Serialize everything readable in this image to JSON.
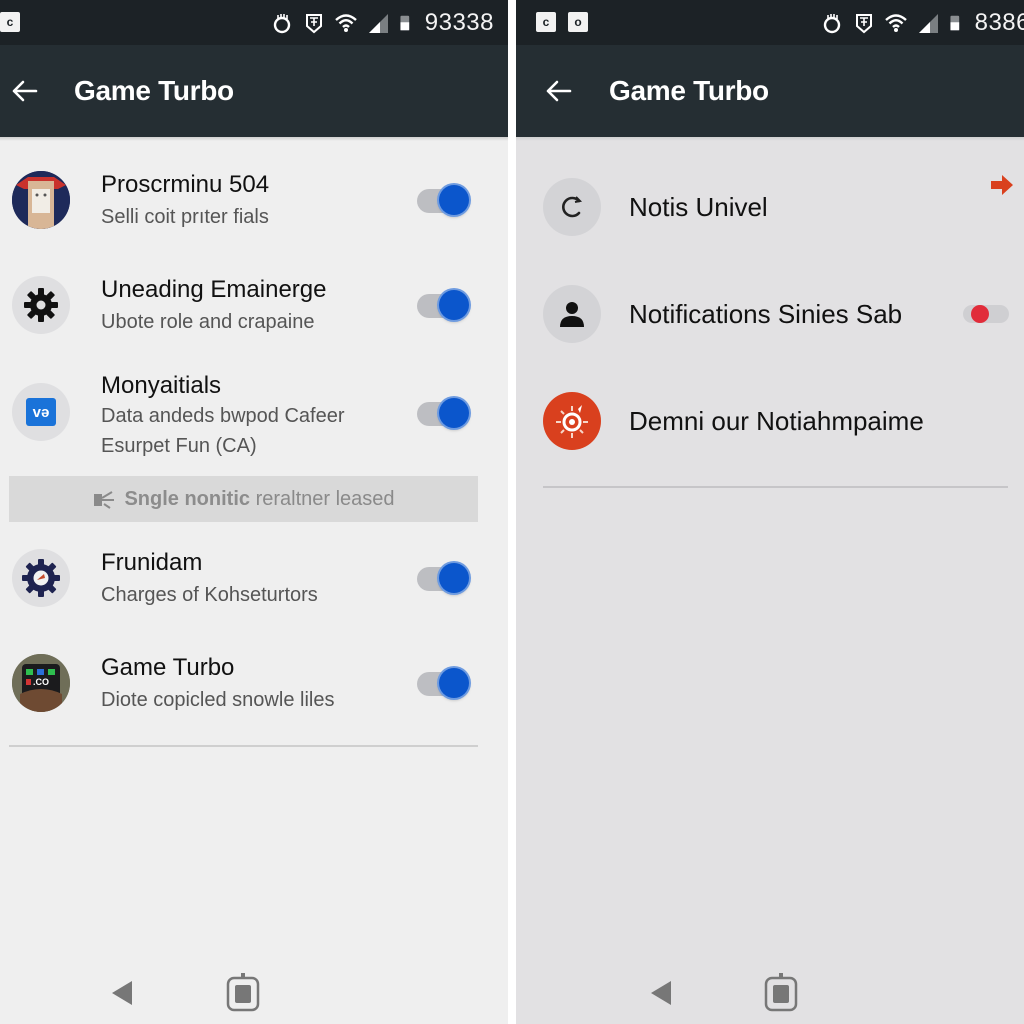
{
  "left": {
    "status_bar": {
      "notification_icons": [
        "c-app-icon"
      ],
      "time_text": "93338"
    },
    "app_bar": {
      "title": "Game Turbo"
    },
    "items": [
      {
        "title": "Proscrminu 504",
        "subtitle": "Selli coit prıter fials",
        "icon": "app-portrait-icon",
        "toggle_on": true
      },
      {
        "title": "Uneading Emainerge",
        "subtitle": "Ubote role and crapaine",
        "icon": "gear-icon",
        "toggle_on": true
      },
      {
        "title": "Monyaitials",
        "subtitle_lines": [
          "Data andeds bwpod Cafeer",
          "Esurpet Fun (CA)"
        ],
        "icon": "vpn-app-icon",
        "toggle_on": true
      },
      {
        "title": "Frunidam",
        "subtitle": "Charges of Kohseturtors",
        "icon": "gear-badge-icon",
        "toggle_on": true
      },
      {
        "title": "Game Turbo",
        "subtitle": "Diote copicled snowle liles",
        "icon": "game-turbo-app-icon",
        "toggle_on": true
      }
    ],
    "notice": {
      "bold_text": "Sngle nonitic",
      "text": "reraltner leased"
    },
    "nav": {
      "back": "back-nav",
      "home": "home-nav"
    }
  },
  "right": {
    "status_bar": {
      "notification_icons": [
        "c-app-icon",
        "o-app-icon"
      ],
      "time_text": "8386"
    },
    "app_bar": {
      "title": "Game Turbo"
    },
    "items": [
      {
        "title": "Notis Univel",
        "icon": "refresh-icon",
        "trailing": "arrow-right-icon"
      },
      {
        "title": "Notifications Sinies Sab",
        "icon": "person-icon",
        "toggle_on": false
      },
      {
        "title": "Demni our Notiahmpaime",
        "icon": "burst-icon"
      }
    ],
    "nav": {
      "back": "back-nav",
      "home": "home-nav"
    }
  },
  "colors": {
    "status_bar": "#1c2226",
    "app_bar": "#252e33",
    "toggle_on": "#0b56cc",
    "toggle_off_thumb": "#e12c3a",
    "accent_orange": "#d9401e"
  }
}
